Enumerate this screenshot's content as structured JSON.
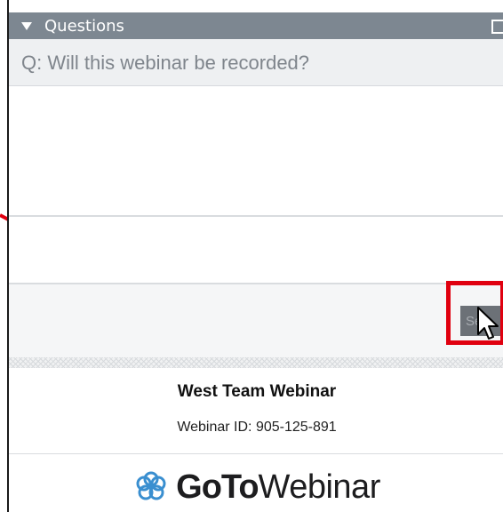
{
  "panel": {
    "title": "Questions"
  },
  "question": {
    "text": "Q: Will this webinar be recorded?"
  },
  "send": {
    "label": "Se"
  },
  "webinar": {
    "name": "West Team Webinar",
    "id_text": "Webinar ID: 905-125-891"
  },
  "branding": {
    "logo_goto": "GoTo",
    "logo_webinar": "Webinar",
    "logo_icon": "flower-icon"
  },
  "colors": {
    "titlebar": "#7d8791",
    "highlight": "#e0000f",
    "logo_icon": "#3a8fd0"
  }
}
